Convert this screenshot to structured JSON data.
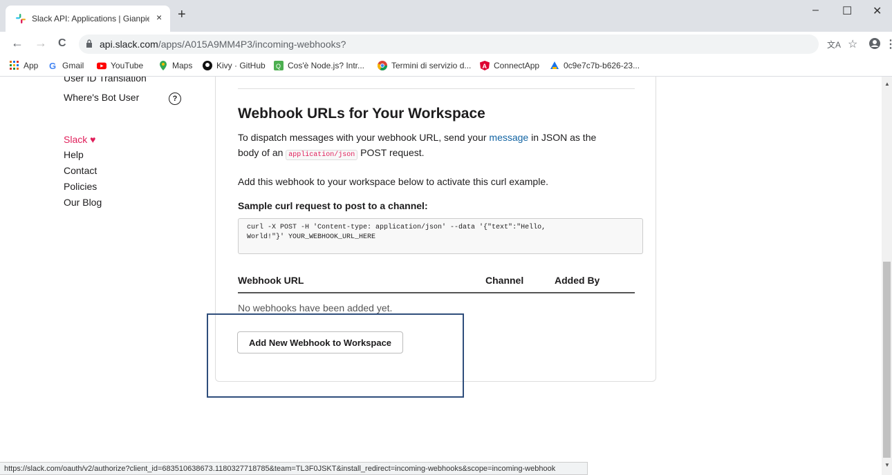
{
  "browser": {
    "tab": {
      "title": "Slack API: Applications | Gianpier",
      "close": "×",
      "favicon": "slack-logo-icon"
    },
    "new_tab": "+",
    "window_controls": {
      "minimize": "–",
      "maximize": "☐",
      "close": "✕"
    },
    "nav": {
      "back": "←",
      "forward": "→",
      "reload": "C"
    },
    "url_domain": "api.slack.com",
    "url_path": "/apps/A015A9MM4P3/incoming-webhooks?",
    "toolbar_icons": [
      "translate-icon",
      "star-icon",
      "profile-icon",
      "menu-icon"
    ],
    "bookmarks": [
      {
        "label": "App",
        "icon": "apps-grid-icon"
      },
      {
        "label": "Gmail",
        "icon": "google-icon"
      },
      {
        "label": "YouTube",
        "icon": "youtube-icon"
      },
      {
        "label": "Maps",
        "icon": "maps-pin-icon"
      },
      {
        "label": "Kivy · GitHub",
        "icon": "github-icon"
      },
      {
        "label": "Cos'è Node.js? Intr...",
        "icon": "node-icon"
      },
      {
        "label": "Termini di servizio d...",
        "icon": "chrome-icon"
      },
      {
        "label": "ConnectApp",
        "icon": "angular-icon"
      },
      {
        "label": "0c9e7c7b-b626-23...",
        "icon": "site-icon"
      }
    ]
  },
  "sidebar": {
    "partial_item": "User ID Translation",
    "bot_user": "Where's Bot User",
    "help_icon": "?",
    "slack_love": "Slack ♥",
    "links": [
      "Help",
      "Contact",
      "Policies",
      "Our Blog"
    ]
  },
  "main": {
    "heading": "Webhook URLs for Your Workspace",
    "desc_part1": "To dispatch messages with your webhook URL, send your ",
    "desc_link": "message",
    "desc_part2": " in JSON as the",
    "desc_part3": "body of an ",
    "desc_code": "application/json",
    "desc_part4": " POST request.",
    "add_info": "Add this webhook to your workspace below to activate this curl example.",
    "sample_heading": "Sample curl request to post to a channel:",
    "code_line1": "curl -X POST -H 'Content-type: application/json' --data '{\"text\":\"Hello,",
    "code_line2": "World!\"}' YOUR_WEBHOOK_URL_HERE",
    "table_headers": {
      "url": "Webhook URL",
      "channel": "Channel",
      "added_by": "Added By"
    },
    "empty_text": "No webhooks have been added yet.",
    "add_button": "Add New Webhook to Workspace"
  },
  "status_url": "https://slack.com/oauth/v2/authorize?client_id=683510638673.1180327718785&team=TL3F0JSKT&install_redirect=incoming-webhooks&scope=incoming-webhook",
  "colors": {
    "slack_pink": "#e01e5a",
    "link_blue": "#1264a3",
    "highlight_box": "#2e4d7b"
  }
}
